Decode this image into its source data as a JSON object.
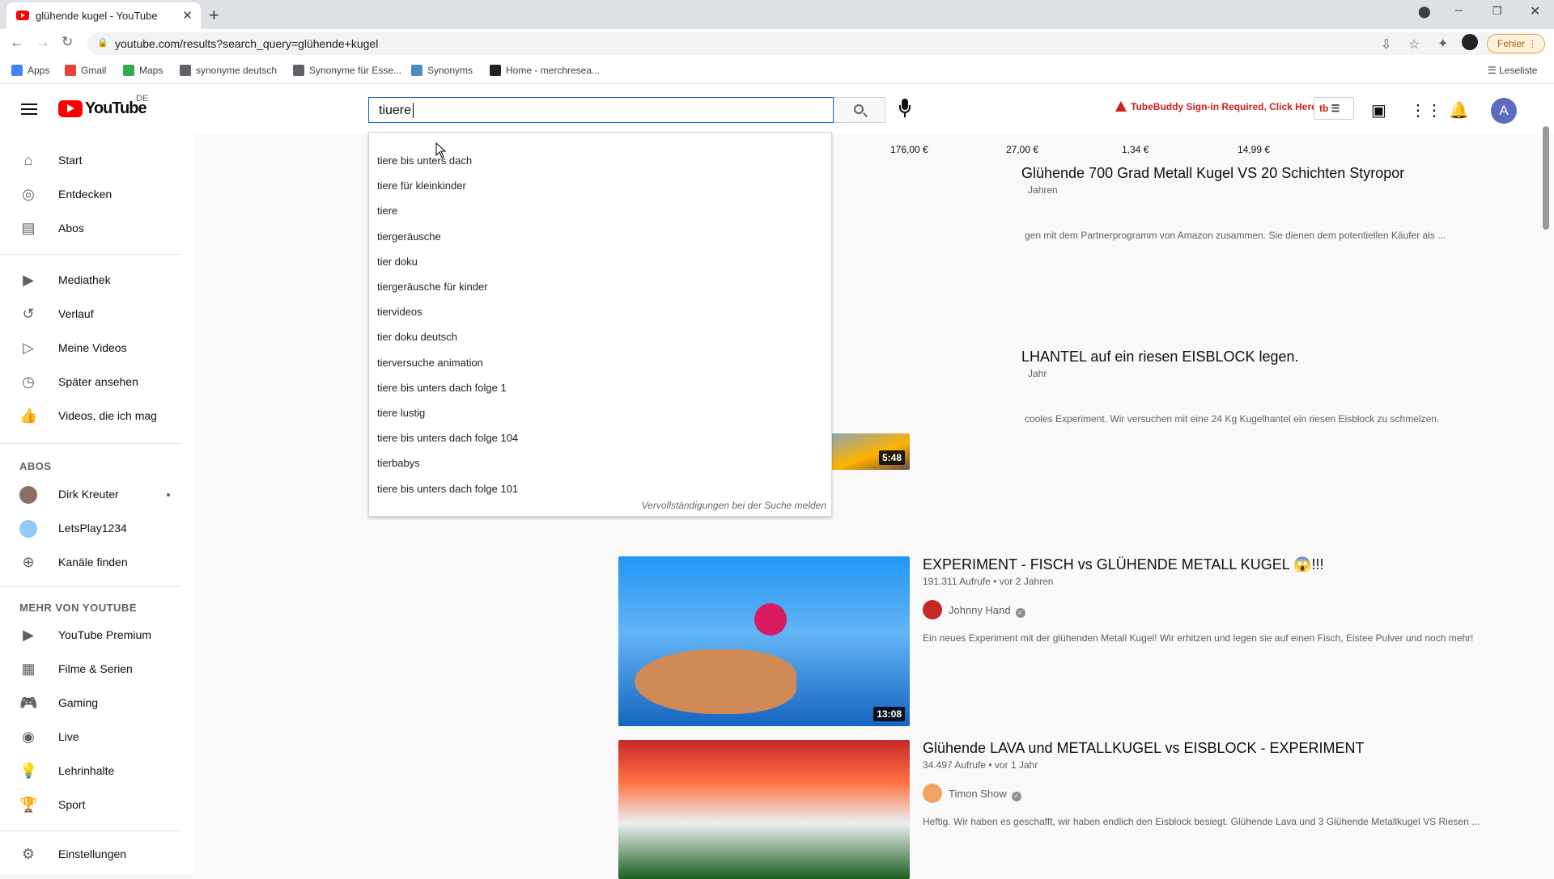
{
  "browser": {
    "tab_title": "glühende kugel - YouTube",
    "url": "youtube.com/results?search_query=glühende+kugel",
    "profile_button": "Fehler",
    "reading_list": "Leseliste",
    "bookmarks": [
      {
        "label": "Apps",
        "color": "#4285f4"
      },
      {
        "label": "Gmail",
        "color": "#ea4335"
      },
      {
        "label": "Maps",
        "color": "#34a853"
      },
      {
        "label": "synonyme deutsch",
        "color": "#5f6368"
      },
      {
        "label": "Synonyme für Esse...",
        "color": "#5f6368"
      },
      {
        "label": "Synonyms",
        "color": "#4b8bbe"
      },
      {
        "label": "Home - merchresea...",
        "color": "#222222"
      }
    ]
  },
  "header": {
    "logo_text": "YouTube",
    "country": "DE",
    "search_value": "tiuere",
    "tubebuddy_text": "TubeBuddy Sign-in Required, Click Here",
    "tb_badge": "tb",
    "avatar_letter": "A"
  },
  "sidebar": {
    "main": [
      {
        "label": "Start",
        "icon": "home-icon"
      },
      {
        "label": "Entdecken",
        "icon": "compass-icon"
      },
      {
        "label": "Abos",
        "icon": "subscriptions-icon"
      }
    ],
    "library": [
      {
        "label": "Mediathek",
        "icon": "library-icon"
      },
      {
        "label": "Verlauf",
        "icon": "history-icon"
      },
      {
        "label": "Meine Videos",
        "icon": "my-videos-icon"
      },
      {
        "label": "Später ansehen",
        "icon": "watch-later-icon"
      },
      {
        "label": "Videos, die ich mag",
        "icon": "thumb-up-icon"
      }
    ],
    "abos_heading": "ABOS",
    "channels": [
      {
        "label": "Dirk Kreuter",
        "color": "#8d6e63"
      },
      {
        "label": "LetsPlay1234",
        "color": "#90caf9"
      },
      {
        "label": "Kanäle finden",
        "color": ""
      }
    ],
    "more_heading": "MEHR VON YOUTUBE",
    "more": [
      {
        "label": "YouTube Premium",
        "icon": "youtube-premium-icon"
      },
      {
        "label": "Filme & Serien",
        "icon": "film-icon"
      },
      {
        "label": "Gaming",
        "icon": "gaming-icon"
      },
      {
        "label": "Live",
        "icon": "live-icon"
      },
      {
        "label": "Lehrinhalte",
        "icon": "lightbulb-icon"
      },
      {
        "label": "Sport",
        "icon": "trophy-icon"
      }
    ],
    "settings": "Einstellungen"
  },
  "shopping": [
    {
      "price": "176,00 €"
    },
    {
      "price": "27,00 €"
    },
    {
      "price": "1,34 €"
    },
    {
      "price": "14,99 €"
    }
  ],
  "results": [
    {
      "title": "Glühende 700 Grad Metall Kugel VS 20 Schichten Styropor",
      "meta": "Jahren",
      "desc": "gen mit dem Partnerprogramm von Amazon zusammen. Sie dienen dem potentiellen Käufer als ..."
    },
    {
      "title": "LHANTEL auf ein riesen EISBLOCK legen.",
      "meta": "Jahr",
      "desc": "cooles Experiment. Wir versuchen mit eine 24 Kg Kugelhantel ein riesen Eisblock zu schmelzen.",
      "duration": "5:48"
    },
    {
      "title": "EXPERIMENT - FISCH vs GLÜHENDE METALL KUGEL 😱!!!",
      "meta": "191.311 Aufrufe • vor 2 Jahren",
      "channel": "Johnny Hand",
      "channel_color": "#c62828",
      "desc": "Ein neues Experiment mit der glühenden Metall Kugel! Wir erhitzen und legen sie auf einen Fisch, Eistee Pulver und noch mehr!",
      "duration": "13:08"
    },
    {
      "title": "Glühende LAVA und METALLKUGEL vs EISBLOCK - EXPERIMENT",
      "meta": "34.497 Aufrufe • vor 1 Jahr",
      "channel": "Timon Show",
      "channel_color": "#f4a261",
      "desc": "Heftig. Wir haben es geschafft, wir haben endlich den Eisblock besiegt. Glühende Lava und 3 Glühende Metallkugel VS Riesen ..."
    }
  ],
  "suggestions": [
    "tiere bis unters dach",
    "tiere für kleinkinder",
    "tiere",
    "tiergeräusche",
    "tier doku",
    "tiergeräusche für kinder",
    "tiervideos",
    "tier doku deutsch",
    "tierversuche animation",
    "tiere bis unters dach folge 1",
    "tiere lustig",
    "tiere bis unters dach folge 104",
    "tierbabys",
    "tiere bis unters dach folge 101"
  ],
  "suggest_report": "Vervollständigungen bei der Suche melden"
}
